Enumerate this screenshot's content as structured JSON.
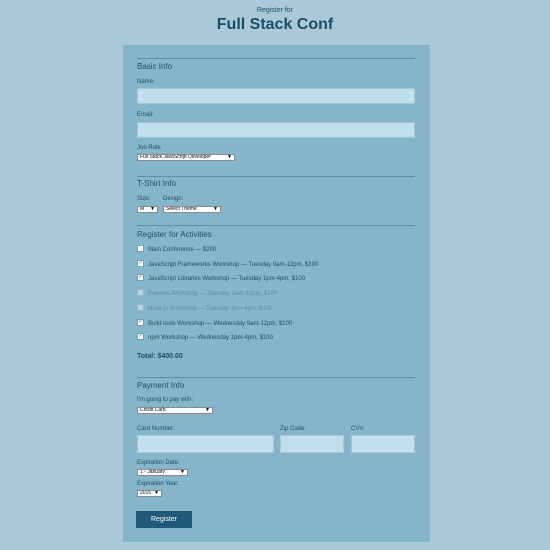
{
  "header": {
    "subtitle": "Register for",
    "title": "Full Stack Conf"
  },
  "basic_info": {
    "section_title": "Basic Info",
    "name_label": "Name:",
    "name_value": "",
    "email_label": "Email:",
    "email_value": "",
    "job_role_label": "Job Role",
    "job_role_selected": "Full Stack JavaScript Developer"
  },
  "tshirt": {
    "section_title": "T-Shirt Info",
    "size_label": "Size:",
    "size_selected": "M",
    "design_label": "Design:",
    "design_selected": "Select Theme"
  },
  "activities": {
    "section_title": "Register for Activities",
    "items": [
      {
        "label": "Main Conference — $200",
        "checked": false,
        "disabled": false
      },
      {
        "label": "JavaScript Frameworks Workshop — Tuesday 9am-12pm, $100",
        "checked": true,
        "disabled": false
      },
      {
        "label": "JavaScript Libraries Workshop — Tuesday 1pm-4pm, $100",
        "checked": true,
        "disabled": false
      },
      {
        "label": "Express Workshop — Tuesday 9am-12pm, $100",
        "checked": false,
        "disabled": true
      },
      {
        "label": "Node.js Workshop — Tuesday 1pm-4pm, $100",
        "checked": false,
        "disabled": true
      },
      {
        "label": "Build tools Workshop — Wednesday 9am-12pm, $100",
        "checked": true,
        "disabled": false
      },
      {
        "label": "npm Workshop — Wednesday 1pm-4pm, $100",
        "checked": true,
        "disabled": false
      }
    ],
    "total": "Total: $400.00"
  },
  "payment": {
    "section_title": "Payment Info",
    "pay_with_label": "I'm going to pay with:",
    "pay_with_selected": "Credit Card",
    "card_number_label": "Card Number:",
    "zip_label": "Zip Code:",
    "cvv_label": "CVV:",
    "exp_date_label": "Expiration Date:",
    "exp_date_selected": "1 - January",
    "exp_year_label": "Expiration Year:",
    "exp_year_selected": "2016"
  },
  "submit_label": "Register"
}
